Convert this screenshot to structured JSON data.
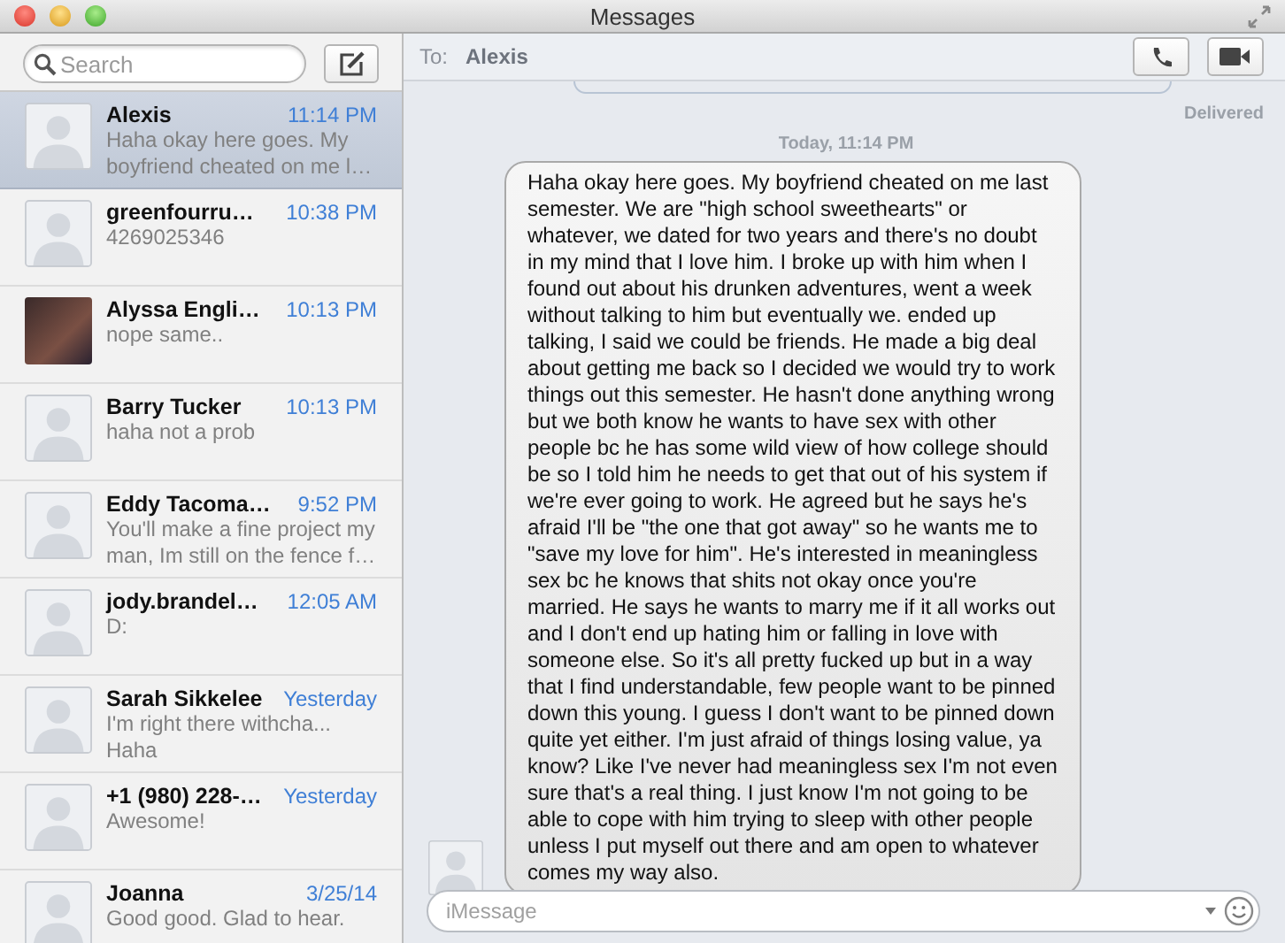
{
  "window": {
    "title": "Messages"
  },
  "search": {
    "placeholder": "Search"
  },
  "conversations": [
    {
      "name": "Alexis",
      "time": "11:14 PM",
      "preview": "Haha okay here goes. My boyfriend cheated on me l…",
      "kind": "generic",
      "selected": true
    },
    {
      "name": "greenfourru…",
      "time": "10:38 PM",
      "preview": "4269025346",
      "kind": "generic",
      "selected": false
    },
    {
      "name": "Alyssa Engli…",
      "time": "10:13 PM",
      "preview": "nope same..",
      "kind": "photo",
      "selected": false
    },
    {
      "name": "Barry Tucker",
      "time": "10:13 PM",
      "preview": "haha not a prob",
      "kind": "generic",
      "selected": false
    },
    {
      "name": "Eddy Tacoma…",
      "time": "9:52 PM",
      "preview": "You'll make a fine project my man, Im still on the fence f…",
      "kind": "generic",
      "selected": false
    },
    {
      "name": "jody.brandel…",
      "time": "12:05 AM",
      "preview": "D:",
      "kind": "generic",
      "selected": false
    },
    {
      "name": "Sarah Sikkelee",
      "time": "Yesterday",
      "preview": "I'm right there withcha...\nHaha",
      "kind": "generic",
      "selected": false
    },
    {
      "name": "+1 (980) 228-…",
      "time": "Yesterday",
      "preview": "Awesome!",
      "kind": "generic",
      "selected": false
    },
    {
      "name": "Joanna",
      "time": "3/25/14",
      "preview": "Good good. Glad to hear.",
      "kind": "generic",
      "selected": false
    }
  ],
  "chat": {
    "to_label": "To:",
    "recipient": "Alexis",
    "status": "Delivered",
    "timestamp": "Today, 11:14 PM",
    "message": "Haha okay here goes. My boyfriend cheated on me last semester. We are \"high school sweethearts\" or whatever, we dated for two years and there's no doubt in my mind that I love him. I broke up with him when I found out about his drunken adventures, went a week without talking to him but eventually we. ended up talking, I said we could be friends. He made a big deal about getting me back so I decided we would try to work things out this semester. He hasn't done anything wrong but we both know he wants to have sex with other people bc he has some wild view of how college should be so I told him he needs to get that out of his system if we're ever going to work. He agreed but he says he's afraid I'll be \"the one that got away\" so he wants me to \"save my love for him\". He's interested in meaningless sex bc he knows that shits not okay once you're married. He says he wants to marry me if it all works out and I don't end up hating him or falling in love with someone else. So it's all pretty fucked up but in a way that I find understandable, few people want to be pinned down this young. I guess I don't want to be pinned down quite yet either. I'm just afraid of things losing value, ya know? Like I've never had meaningless sex I'm not even sure that's a real thing. I just know I'm not going to be able to cope with him trying to sleep with other people unless I put myself out there and am open to whatever comes my way also.",
    "input_placeholder": "iMessage"
  }
}
